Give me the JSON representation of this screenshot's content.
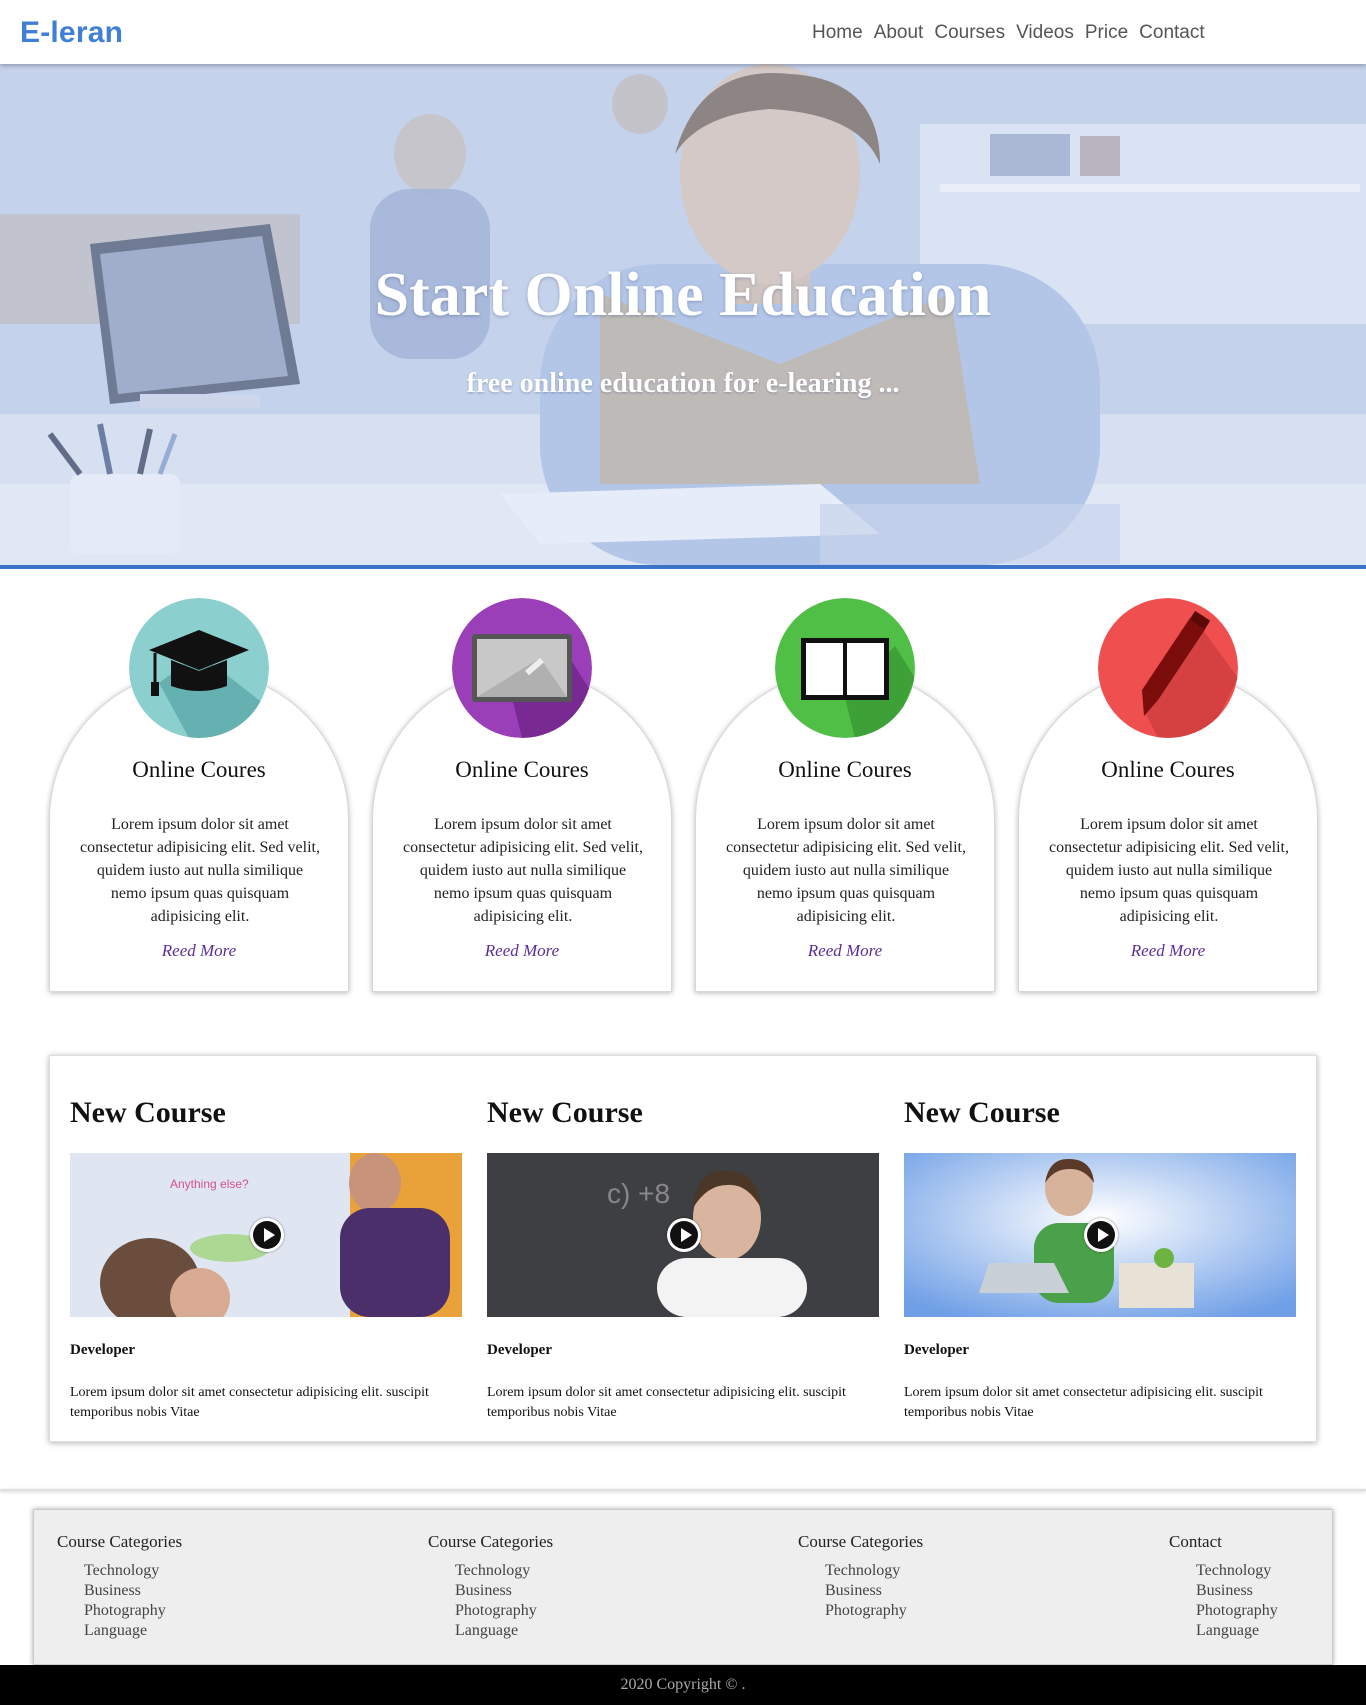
{
  "header": {
    "logo": "E-leran",
    "nav": [
      "Home",
      "About",
      "Courses",
      "Videos",
      "Price",
      "Contact"
    ]
  },
  "hero": {
    "title": "Start Online Education",
    "subtitle": "free online education for e-learing ..."
  },
  "features": [
    {
      "icon": "graduation-cap-icon",
      "color": "#8ccfcf",
      "title": "Online Coures",
      "text": "Lorem ipsum dolor sit amet consectetur adipisicing elit. Sed velit, quidem iusto aut nulla similique nemo ipsum quas quisquam adipisicing elit.",
      "link": "Reed More"
    },
    {
      "icon": "whiteboard-icon",
      "color": "#9a3fb8",
      "title": "Online Coures",
      "text": "Lorem ipsum dolor sit amet consectetur adipisicing elit. Sed velit, quidem iusto aut nulla similique nemo ipsum quas quisquam adipisicing elit.",
      "link": "Reed More"
    },
    {
      "icon": "book-icon",
      "color": "#4fbf45",
      "title": "Online Coures",
      "text": "Lorem ipsum dolor sit amet consectetur adipisicing elit. Sed velit, quidem iusto aut nulla similique nemo ipsum quas quisquam adipisicing elit.",
      "link": "Reed More"
    },
    {
      "icon": "pen-icon",
      "color": "#f04f4f",
      "title": "Online Coures",
      "text": "Lorem ipsum dolor sit amet consectetur adipisicing elit. Sed velit, quidem iusto aut nulla similique nemo ipsum quas quisquam adipisicing elit.",
      "link": "Reed More"
    }
  ],
  "courses": [
    {
      "title": "New Course",
      "role": "Developer",
      "desc": "Lorem ipsum dolor sit amet consectetur adipisicing elit. suscipit temporibus nobis Vitae"
    },
    {
      "title": "New Course",
      "role": "Developer",
      "desc": "Lorem ipsum dolor sit amet consectetur adipisicing elit. suscipit temporibus nobis Vitae"
    },
    {
      "title": "New Course",
      "role": "Developer",
      "desc": "Lorem ipsum dolor sit amet consectetur adipisicing elit. suscipit temporibus nobis Vitae"
    }
  ],
  "footer": {
    "columns": [
      {
        "title": "Course Categories",
        "items": [
          "Technology",
          "Business",
          "Photography",
          "Language"
        ]
      },
      {
        "title": "Course Categories",
        "items": [
          "Technology",
          "Business",
          "Photography",
          "Language"
        ]
      },
      {
        "title": "Course Categories",
        "items": [
          "Technology",
          "Business",
          "Photography"
        ]
      },
      {
        "title": "Contact",
        "items": [
          "Technology",
          "Business",
          "Photography",
          "Language"
        ]
      }
    ],
    "copyright": "2020 Copyright © ."
  },
  "colors": {
    "brand": "#3f7fd6",
    "hero_border": "#3b73c8",
    "link": "#5b2d9a"
  }
}
